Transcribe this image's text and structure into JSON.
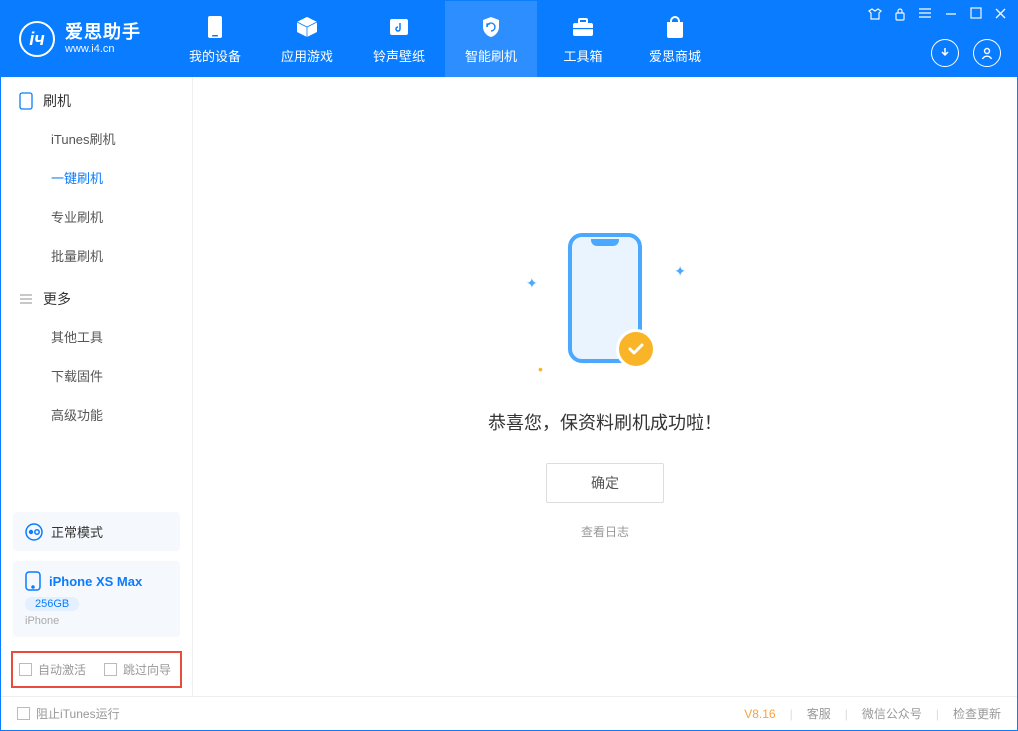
{
  "app": {
    "title": "爱思助手",
    "url": "www.i4.cn"
  },
  "nav": {
    "items": [
      {
        "label": "我的设备"
      },
      {
        "label": "应用游戏"
      },
      {
        "label": "铃声壁纸"
      },
      {
        "label": "智能刷机"
      },
      {
        "label": "工具箱"
      },
      {
        "label": "爱思商城"
      }
    ]
  },
  "sidebar": {
    "group1": {
      "title": "刷机",
      "items": [
        "iTunes刷机",
        "一键刷机",
        "专业刷机",
        "批量刷机"
      ]
    },
    "group2": {
      "title": "更多",
      "items": [
        "其他工具",
        "下载固件",
        "高级功能"
      ]
    },
    "mode": {
      "label": "正常模式"
    },
    "device": {
      "name": "iPhone XS Max",
      "storage": "256GB",
      "type": "iPhone"
    },
    "checks": {
      "auto_activate": "自动激活",
      "skip_guide": "跳过向导"
    }
  },
  "main": {
    "success": "恭喜您，保资料刷机成功啦！",
    "ok": "确定",
    "view_log": "查看日志"
  },
  "footer": {
    "block_itunes": "阻止iTunes运行",
    "version": "V8.16",
    "links": {
      "service": "客服",
      "wechat": "微信公众号",
      "update": "检查更新"
    }
  }
}
